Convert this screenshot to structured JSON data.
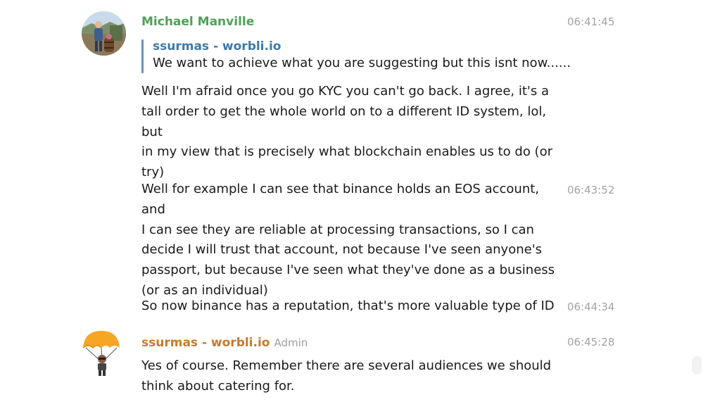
{
  "colors": {
    "michael_name": "#4fa05b",
    "ssurmas_name": "#c57a2f",
    "reply_name": "#3e79a8",
    "reply_bar": "#6a93b8",
    "timestamp": "#a3a3a3"
  },
  "messages": [
    {
      "sender": "Michael Manville",
      "time": "06:41:45",
      "avatar": "photo-avatar",
      "reply": {
        "name": "ssurmas - worbli.io",
        "text": "We want to achieve what you are suggesting but this isnt now......"
      },
      "text": "Well I'm afraid once you go KYC you can't go back. I agree, it's a\ntall order to get the whole world on to a different ID system, lol, but\nin my view that is precisely what blockchain enables us to do (or\ntry)"
    },
    {
      "time": "06:43:52",
      "text": "Well for example I can see that binance holds an EOS account, and\nI can see they are reliable at processing transactions, so I can\ndecide I will trust that account, not because I've seen anyone's\npassport, but because I've seen what they've done as a business\n(or as an individual)"
    },
    {
      "time": "06:44:34",
      "text": "So now binance has a reputation, that's more valuable type of ID"
    },
    {
      "sender": "ssurmas - worbli.io",
      "badge": "Admin",
      "time": "06:45:28",
      "avatar": "parachute-avatar",
      "text": "Yes of course. Remember there are several audiences we should\nthink about catering for."
    }
  ]
}
